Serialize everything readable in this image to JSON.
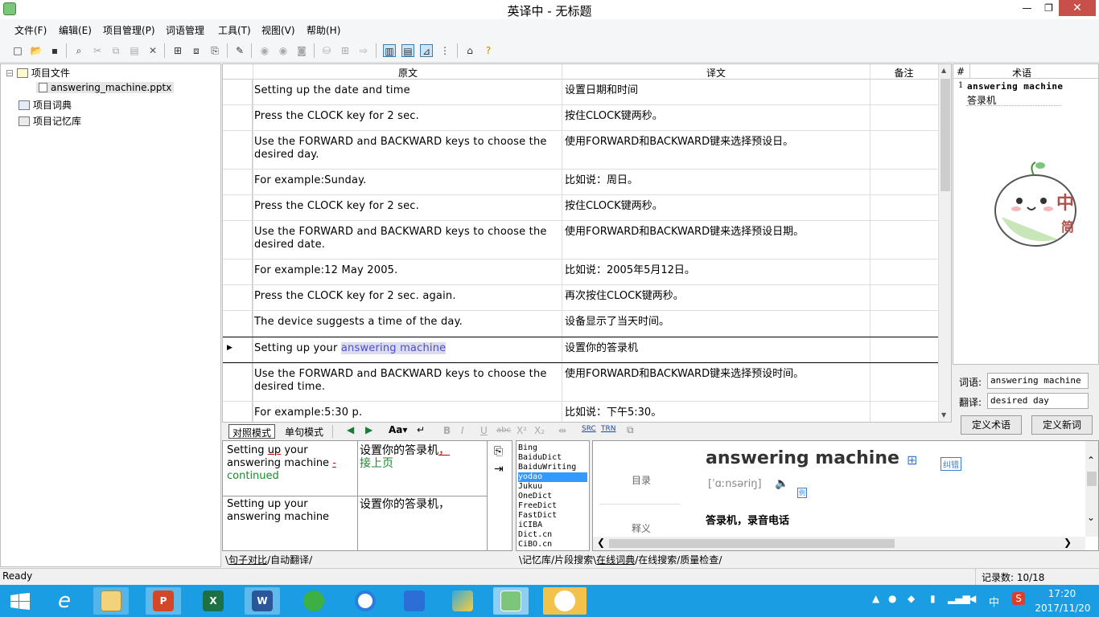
{
  "window": {
    "title": "英译中 - 无标题",
    "minimize": "—",
    "maximize": "❐",
    "close": "✕"
  },
  "menu": [
    "文件(F)",
    "编辑(E)",
    "项目管理(P)",
    "词语管理",
    "工具(T)",
    "视图(V)",
    "帮助(H)"
  ],
  "toolbar_icons": [
    "new-icon",
    "open-icon",
    "save-icon",
    "find-icon",
    "cut-icon",
    "copy-icon",
    "paste-icon",
    "delete-icon",
    "add-file-icon",
    "import-icon",
    "export-icon",
    "notes-icon",
    "translate-icon",
    "prev-icon",
    "next-icon",
    "db-icon",
    "db-add-icon",
    "db-export-icon",
    "view-compare-icon",
    "view-single-icon",
    "view-align-icon",
    "view-tree-icon",
    "home-icon",
    "help-icon"
  ],
  "tree": {
    "root": "项目文件",
    "file": "answering_machine.pptx",
    "dict": "项目词典",
    "memory": "项目记忆库"
  },
  "grid": {
    "headers": {
      "source": "原文",
      "target": "译文",
      "notes": "备注"
    },
    "rows": [
      {
        "source": "Setting up the date and time",
        "target": "设置日期和时间"
      },
      {
        "source": "Press the CLOCK key for 2 sec.",
        "target": "按住CLOCK键两秒。"
      },
      {
        "source": "Use the FORWARD and BACKWARD keys to choose the desired day.",
        "target": "使用FORWARD和BACKWARD键来选择预设日。"
      },
      {
        "source": "For example:Sunday.",
        "target": "比如说：周日。"
      },
      {
        "source": "Press the CLOCK key for 2 sec.",
        "target": "按住CLOCK键两秒。"
      },
      {
        "source": "Use the FORWARD and BACKWARD keys to choose the desired date.",
        "target": "使用FORWARD和BACKWARD键来选择预设日期。"
      },
      {
        "source": "For example:12 May 2005.",
        "target": "比如说：2005年5月12日。"
      },
      {
        "source": "Press the CLOCK key for 2 sec. again.",
        "target": "再次按住CLOCK键两秒。"
      },
      {
        "source": "The device suggests a time of the day.",
        "target": "设备显示了当天时间。"
      },
      {
        "source_prefix": "Setting up your ",
        "source_highlight": "answering machine",
        "target": "设置你的答录机",
        "current": true
      },
      {
        "source": "Use the FORWARD and BACKWARD keys to choose the desired time.",
        "target": "使用FORWARD和BACKWARD键来选择预设时间。"
      },
      {
        "source": "For example:5:30 p.",
        "target": "比如说：下午5:30。"
      }
    ],
    "current_marker": "▶"
  },
  "terms": {
    "headers": {
      "num": "#",
      "term": "术语"
    },
    "entries": [
      {
        "num": "1",
        "en": "answering machine",
        "zh": "答录机"
      }
    ],
    "sticker": {
      "char1": "中",
      "char2": "简"
    }
  },
  "term_form": {
    "word_label": "词语:",
    "word_value": "answering machine",
    "trans_label": "翻译:",
    "trans_value": "desired day",
    "define_term": "定义术语",
    "define_word": "定义新词"
  },
  "modebar": {
    "compare": "对照模式",
    "single": "单句模式",
    "font": "Aa▾"
  },
  "editor": {
    "src1_a": "Setting ",
    "src1_b": "up",
    "src1_c": " your answering machine ",
    "src1_d": "-",
    "src1_e": "continued",
    "tgt1_a": "设置你的答录机",
    "tgt1_b": "，",
    "tgt1_c": "接上页",
    "src2": "Setting up your answering machine",
    "tgt2": "设置你的答录机，"
  },
  "dicts": [
    "Bing",
    "BaiduDict",
    "BaiduWriting",
    "yodao",
    "Jukuu",
    "OneDict",
    "FreeDict",
    "FastDict",
    "iCIBA",
    "Dict.cn",
    "CiBO.cn"
  ],
  "dict_selected": "yodao",
  "dict_view": {
    "nav1": "目录",
    "nav2": "释义",
    "headword": "answering machine",
    "phonetic": "[ˈɑːnsəriŋ]",
    "meaning": "答录机，录音电话",
    "report": "纠错",
    "example_badge": "例"
  },
  "bottom_tabs_left": [
    "句子对比",
    "自动翻译"
  ],
  "bottom_tabs_right": [
    "记忆库",
    "片段搜索",
    "在线词典",
    "在线搜索",
    "质量检查"
  ],
  "status": {
    "left": "Ready",
    "right": "记录数: 10/18"
  },
  "taskbar": {
    "time": "17:20",
    "date": "2017/11/20",
    "ime": "中"
  }
}
